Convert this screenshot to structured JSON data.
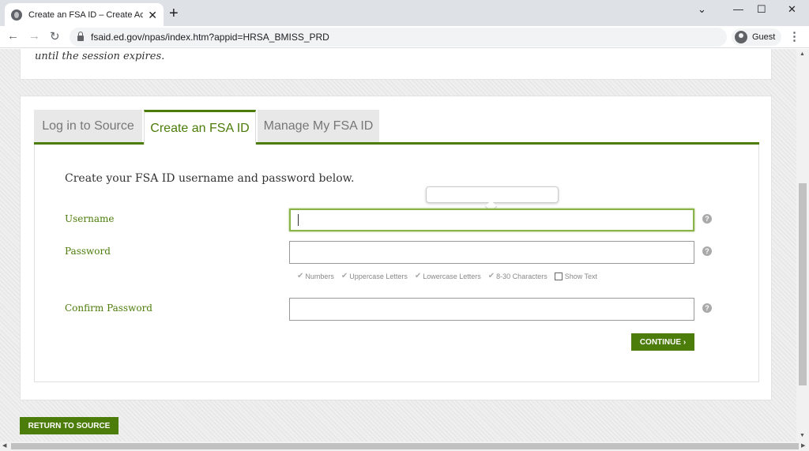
{
  "browser": {
    "tab_title": "Create an FSA ID – Create Accou",
    "tab_close": "✕",
    "new_tab": "+",
    "url": "fsaid.ed.gov/npas/index.htm?appid=HRSA_BMISS_PRD",
    "profile_label": "Guest",
    "icons": {
      "back": "←",
      "forward": "→",
      "reload": "↻",
      "minimize": "⌄",
      "restore": "☐",
      "close": "✕",
      "maximize": "—",
      "menu": "⋮"
    }
  },
  "page": {
    "session_text": "until the session expires.",
    "tabs": [
      {
        "label": "Log in to Source",
        "active": false
      },
      {
        "label": "Create an FSA ID",
        "active": true
      },
      {
        "label": "Manage My FSA ID",
        "active": false
      }
    ],
    "form": {
      "heading": "Create your FSA ID username and password below.",
      "username_label": "Username",
      "username_value": "",
      "password_label": "Password",
      "password_value": "",
      "requirements": [
        "Numbers",
        "Uppercase Letters",
        "Lowercase Letters",
        "8-30 Characters"
      ],
      "show_text_label": "Show Text",
      "confirm_label": "Confirm Password",
      "confirm_value": "",
      "help_glyph": "?",
      "continue_label": "CONTINUE ›"
    },
    "return_label": "RETURN TO SOURCE"
  },
  "colors": {
    "brand_green": "#4c7c0a",
    "focus_green": "#8ab34a"
  }
}
